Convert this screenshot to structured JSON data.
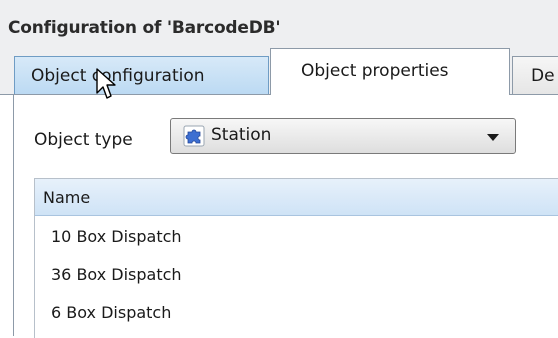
{
  "window": {
    "title": "Configuration of 'BarcodeDB'"
  },
  "tabs": [
    {
      "label": "Object configuration",
      "state": "hover"
    },
    {
      "label": "Object properties",
      "state": "selected"
    },
    {
      "label": "De",
      "state": "normal"
    }
  ],
  "object_type": {
    "label": "Object type",
    "selected": "Station",
    "icon": "puzzle-piece-icon"
  },
  "table": {
    "columns": [
      "Name"
    ],
    "rows": [
      {
        "name": "10 Box Dispatch"
      },
      {
        "name": "36 Box Dispatch"
      },
      {
        "name": "6 Box Dispatch"
      }
    ]
  },
  "colors": {
    "tab_hover": "#bcdaf3",
    "header": "#cfe3f6",
    "puzzle_icon": "#3d6fd1"
  }
}
